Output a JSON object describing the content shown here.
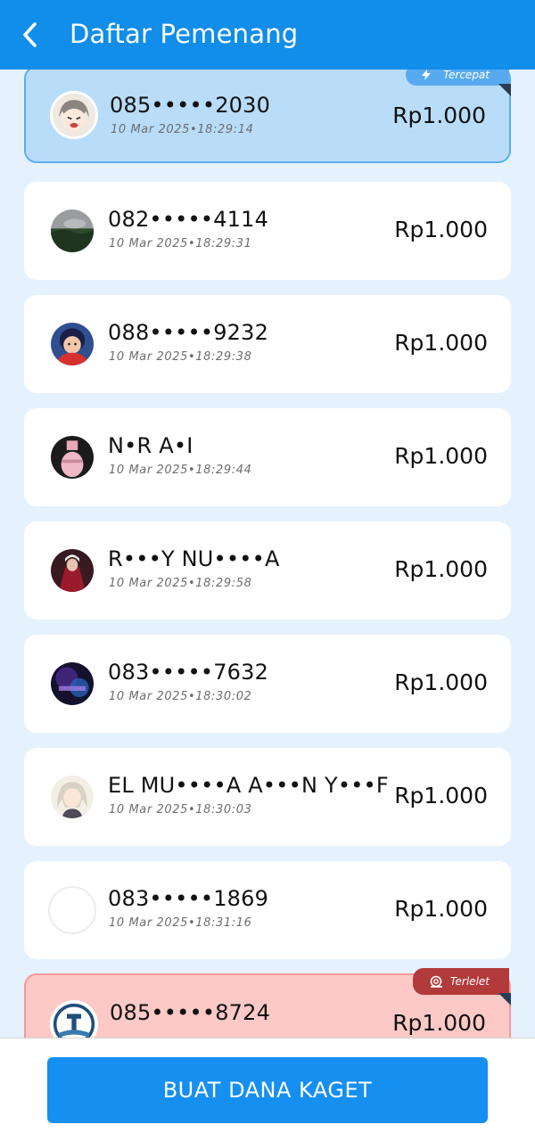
{
  "header": {
    "title": "Daftar Pemenang"
  },
  "winners": [
    {
      "name": "085•••••2030",
      "time": "10 Mar 2025•18:29:14",
      "amount": "Rp1.000",
      "badge": "Tercepat"
    },
    {
      "name": "082•••••4114",
      "time": "10 Mar 2025•18:29:31",
      "amount": "Rp1.000"
    },
    {
      "name": "088•••••9232",
      "time": "10 Mar 2025•18:29:38",
      "amount": "Rp1.000"
    },
    {
      "name": "N•R A•I",
      "time": "10 Mar 2025•18:29:44",
      "amount": "Rp1.000"
    },
    {
      "name": "R•••Y NU••••A",
      "time": "10 Mar 2025•18:29:58",
      "amount": "Rp1.000"
    },
    {
      "name": "083•••••7632",
      "time": "10 Mar 2025•18:30:02",
      "amount": "Rp1.000"
    },
    {
      "name": "EL MU••••A A•••N Y•••F",
      "time": "10 Mar 2025•18:30:03",
      "amount": "Rp1.000"
    },
    {
      "name": "083•••••1869",
      "time": "10 Mar 2025•18:31:16",
      "amount": "Rp1.000"
    },
    {
      "name": "085•••••8724",
      "time": "",
      "amount": "Rp1.000",
      "badge": "Terlelet"
    }
  ],
  "footer": {
    "button_label": "BUAT DANA KAGET"
  },
  "colors": {
    "primary": "#118dea",
    "button": "#158ff0",
    "fastest_card": "#b9dcf8",
    "slowest_card": "#fcc9c6",
    "slowest_badge": "#b23a3a"
  },
  "icons": {
    "back": "chevron-left-icon",
    "fastest_badge": "lightning-icon",
    "slowest_badge": "snail-icon"
  }
}
